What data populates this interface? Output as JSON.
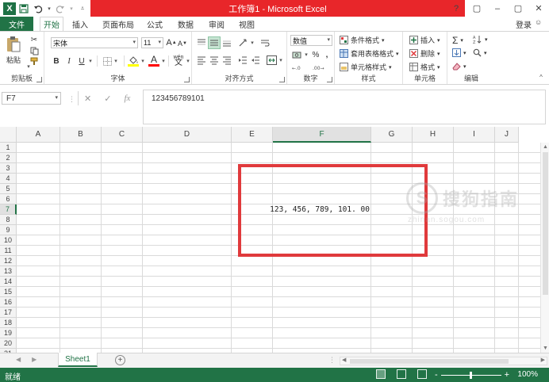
{
  "window": {
    "title": "工作簿1 - Microsoft Excel",
    "controls": [
      "?",
      "▢",
      "–",
      "▢",
      "✕"
    ]
  },
  "quick_access": {
    "icons": [
      "excel-logo",
      "save-icon",
      "undo-icon",
      "redo-icon",
      "customize-icon"
    ],
    "logo_letter": "X"
  },
  "ribbon_tabs": [
    "文件",
    "开始",
    "插入",
    "页面布局",
    "公式",
    "数据",
    "审阅",
    "视图"
  ],
  "active_tab": "开始",
  "account": {
    "login_label": "登录"
  },
  "ribbon": {
    "clipboard": {
      "label": "剪贴板",
      "paste_label": "粘贴"
    },
    "font": {
      "label": "字体",
      "font_name": "宋体",
      "font_size": "11",
      "bold": "B",
      "italic": "I",
      "underline": "U",
      "grow": "A",
      "shrink": "A",
      "font_color_letter": "A",
      "wen_label": "wén"
    },
    "alignment": {
      "label": "对齐方式"
    },
    "number": {
      "label": "数字",
      "format": "数值",
      "percent": "%",
      "comma": ","
    },
    "styles": {
      "label": "样式",
      "conditional": "条件格式",
      "table": "套用表格格式",
      "cell_styles": "单元格样式"
    },
    "cells": {
      "label": "单元格",
      "insert": "插入",
      "delete": "删除",
      "format": "格式"
    },
    "editing": {
      "label": "编辑"
    }
  },
  "formula_bar": {
    "name_box": "F7",
    "formula": "123456789101",
    "fx": "fx"
  },
  "grid": {
    "columns": [
      "A",
      "B",
      "C",
      "D",
      "E",
      "F",
      "G",
      "H",
      "I",
      "J"
    ],
    "rows": [
      "1",
      "2",
      "3",
      "4",
      "5",
      "6",
      "7",
      "8",
      "9",
      "10",
      "11",
      "12",
      "13",
      "14",
      "15",
      "16",
      "17",
      "18",
      "19",
      "20",
      "21"
    ],
    "selected_cell": {
      "column": "F",
      "row": "7"
    },
    "cell_f7_display": "123, 456, 789, 101. 00"
  },
  "sheets": {
    "tabs": [
      "Sheet1"
    ],
    "add_label": "+"
  },
  "status_bar": {
    "status": "就绪",
    "zoom": "100%",
    "zoom_minus": "-",
    "zoom_plus": "+"
  },
  "watermark": {
    "brand": "搜狗指南",
    "url": "zhinan.sogou.com",
    "glyph": "S"
  },
  "colors": {
    "excel_green": "#217346",
    "title_red": "#e8262a",
    "highlight_red": "#e03a3c"
  }
}
